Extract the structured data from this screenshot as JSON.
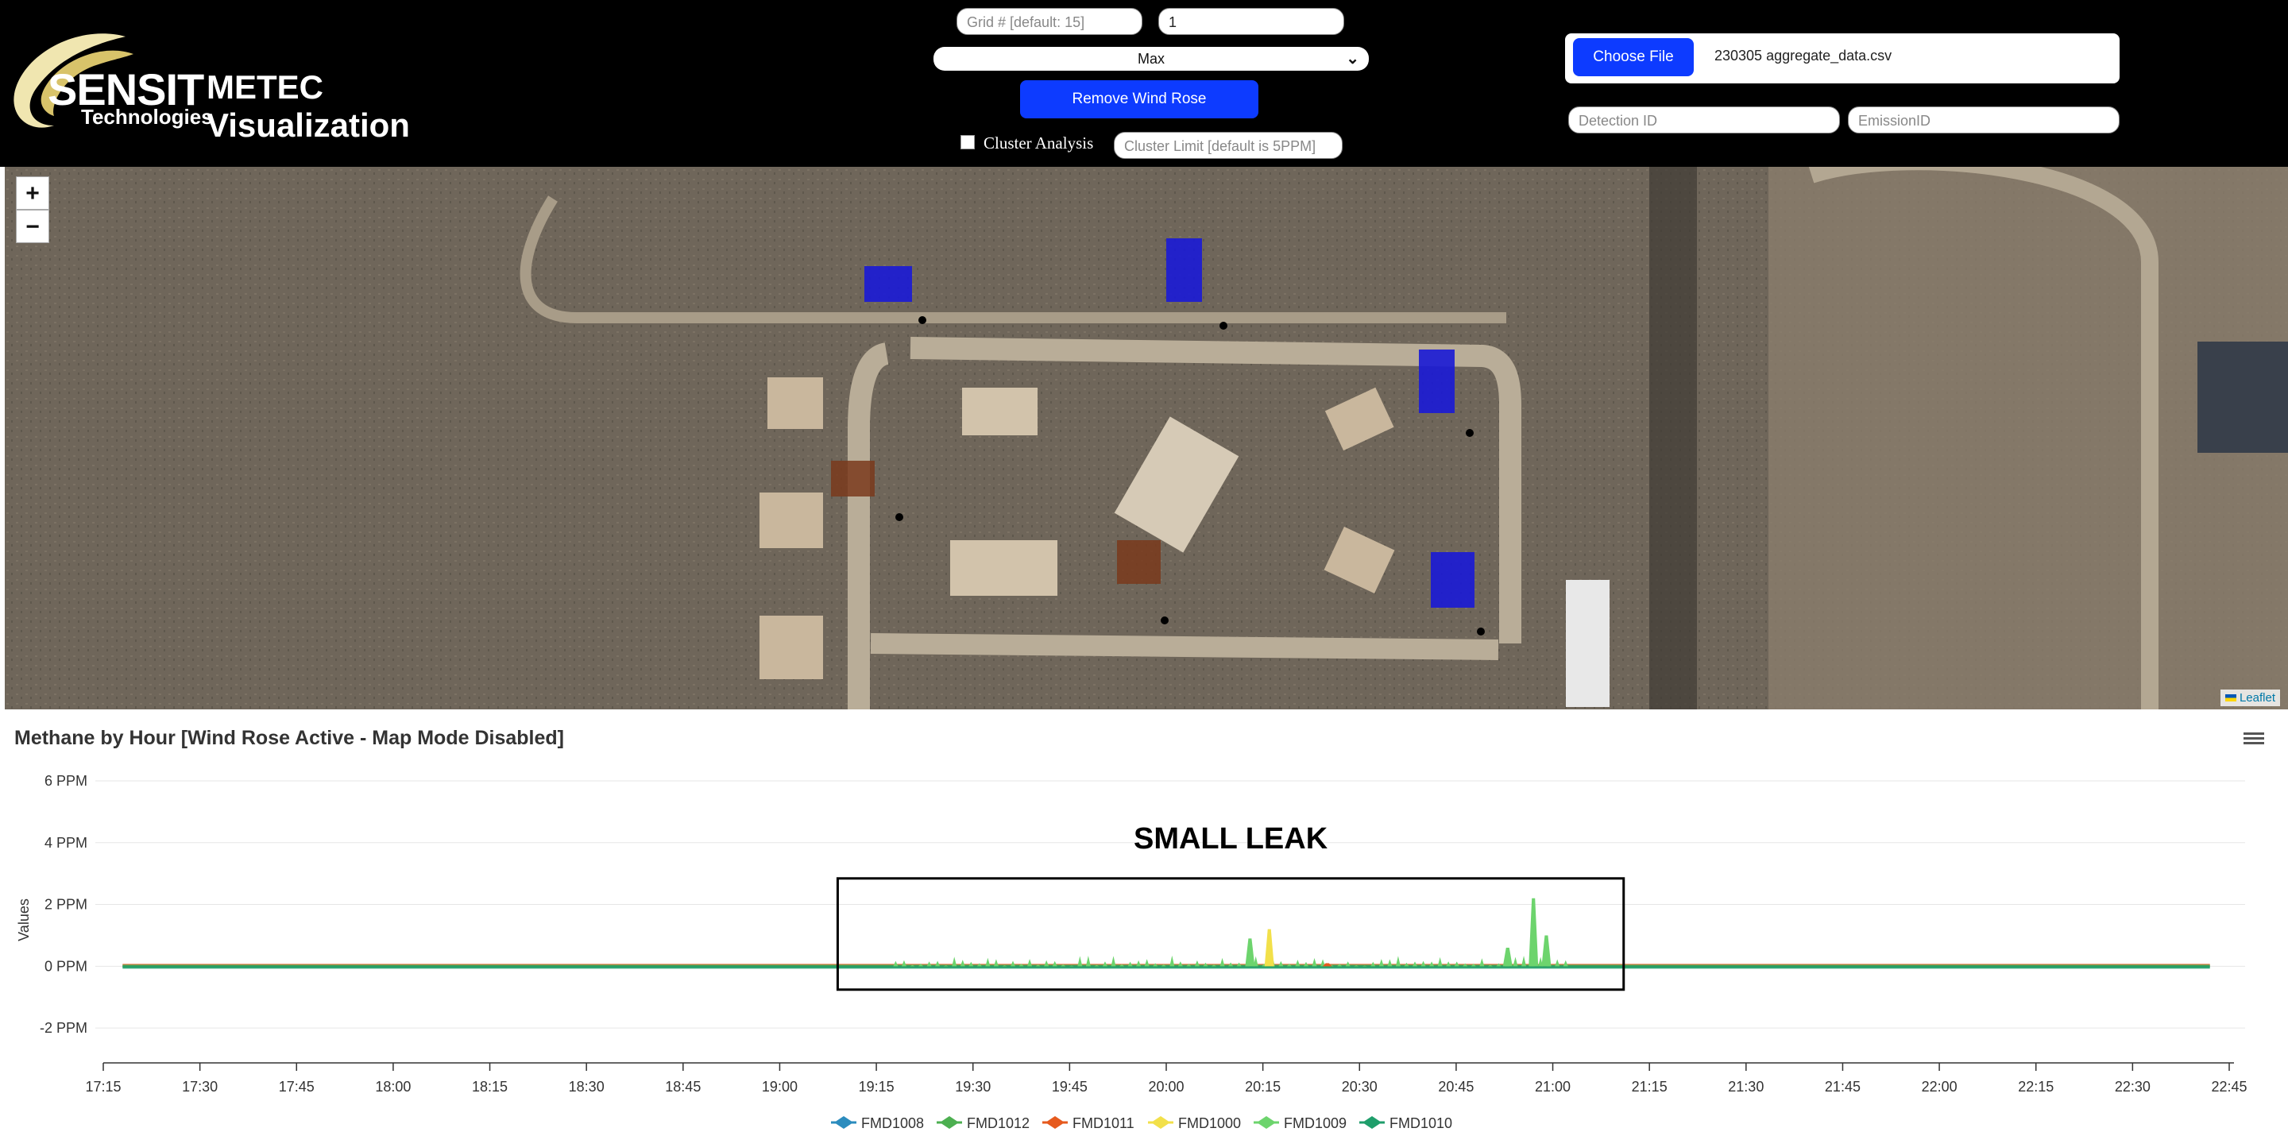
{
  "logo": {
    "brand": "SENSIT",
    "brand_suffix": "Technologies",
    "title": "METEC Visualization"
  },
  "controls": {
    "grid_placeholder": "Grid # [default: 15]",
    "grid_value_2": "1",
    "mode_select": "Max",
    "remove_wind_rose": "Remove Wind Rose",
    "cluster_analysis_label": "Cluster Analysis",
    "cluster_limit_placeholder": "Cluster Limit [default is 5PPM]"
  },
  "file": {
    "choose_label": "Choose File",
    "file_name": "230305 aggregate_data.csv",
    "detection_placeholder": "Detection ID",
    "emission_placeholder": "EmissionID"
  },
  "map": {
    "attribution": "Leaflet",
    "zoom_in": "+",
    "zoom_out": "−"
  },
  "chart_title": "Methane by Hour [Wind Rose Active - Map Mode Disabled]",
  "chart_data": {
    "type": "line",
    "title": "Methane by Hour [Wind Rose Active - Map Mode Disabled]",
    "ylabel": "Values",
    "ylim": [
      -3,
      6
    ],
    "y_ticks": [
      "6 PPM",
      "4 PPM",
      "2 PPM",
      "0 PPM",
      "-2 PPM"
    ],
    "x_ticks": [
      "17:15",
      "17:30",
      "17:45",
      "18:00",
      "18:15",
      "18:30",
      "18:45",
      "19:00",
      "19:15",
      "19:30",
      "19:45",
      "20:00",
      "20:15",
      "20:30",
      "20:45",
      "21:00",
      "21:15",
      "21:30",
      "21:45",
      "22:00",
      "22:15",
      "22:30",
      "22:45"
    ],
    "annotation": "SMALL LEAK",
    "series": [
      {
        "name": "FMD1008",
        "color": "#2b8cbe",
        "marker": "diamond"
      },
      {
        "name": "FMD1012",
        "color": "#4caf50",
        "marker": "diamond"
      },
      {
        "name": "FMD1011",
        "color": "#e65a1e",
        "marker": "diamond"
      },
      {
        "name": "FMD1000",
        "color": "#f2e04a",
        "marker": "diamond"
      },
      {
        "name": "FMD1009",
        "color": "#6dd46d",
        "marker": "diamond"
      },
      {
        "name": "FMD1010",
        "color": "#1f9e6b",
        "marker": "diamond"
      }
    ],
    "peaks": [
      {
        "series": "FMD1009",
        "time": "20:13",
        "value": 0.9
      },
      {
        "series": "FMD1000",
        "time": "20:16",
        "value": 1.2
      },
      {
        "series": "FMD1009",
        "time": "20:57",
        "value": 2.2
      },
      {
        "series": "FMD1009",
        "time": "20:59",
        "value": 1.0
      },
      {
        "series": "FMD1009",
        "time": "20:53",
        "value": 0.6
      },
      {
        "series": "FMD1011",
        "time": "20:25",
        "value": 0.1
      }
    ]
  }
}
